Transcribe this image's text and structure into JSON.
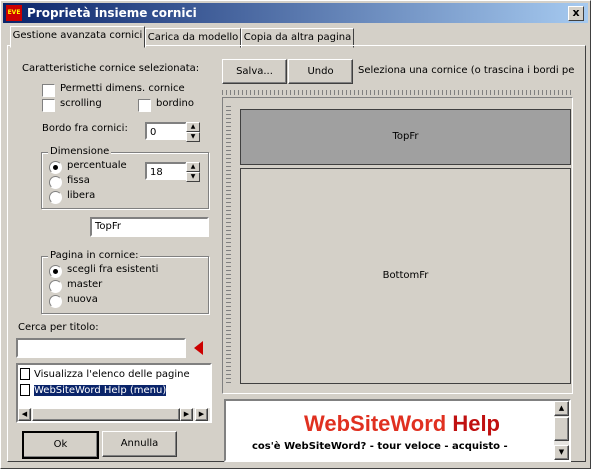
{
  "window": {
    "title": "Proprietà insieme cornici",
    "close": "x"
  },
  "tabs": [
    "Gestione avanzata cornici",
    "Carica da modello",
    "Copia da altra pagina"
  ],
  "left": {
    "section_label": "Caratteristiche cornice selezionata:",
    "chk_resize": "Permetti dimens. cornice",
    "chk_scrolling": "scrolling",
    "chk_border": "bordino",
    "border_label": "Bordo fra cornici:",
    "border_value": "0",
    "dim_group": "Dimensione",
    "dim_options": [
      "percentuale",
      "fissa",
      "libera"
    ],
    "dim_value": "18",
    "frame_name": "TopFr",
    "page_group": "Pagina in cornice:",
    "page_options": [
      "scegli fra esistenti",
      "master",
      "nuova"
    ],
    "search_label": "Cerca per titolo:",
    "search_value": "",
    "list_items": [
      "Visualizza l'elenco delle pagine",
      "WebSiteWord Help (menu)"
    ]
  },
  "buttons": {
    "save": "Salva...",
    "undo": "Undo",
    "ok": "Ok",
    "cancel": "Annulla"
  },
  "hint": "Seleziona una cornice (o trascina i bordi per c",
  "frames": {
    "top": "TopFr",
    "bottom": "BottomFr"
  },
  "preview": {
    "brand_a": "WebSiteWord",
    "brand_b": " Help",
    "nav": "cos'è WebSiteWord? - tour veloce - acquisto -"
  },
  "colors": {
    "brand_red": "#e03020",
    "selection": "#0a246a",
    "arrow": "#cc0000"
  }
}
